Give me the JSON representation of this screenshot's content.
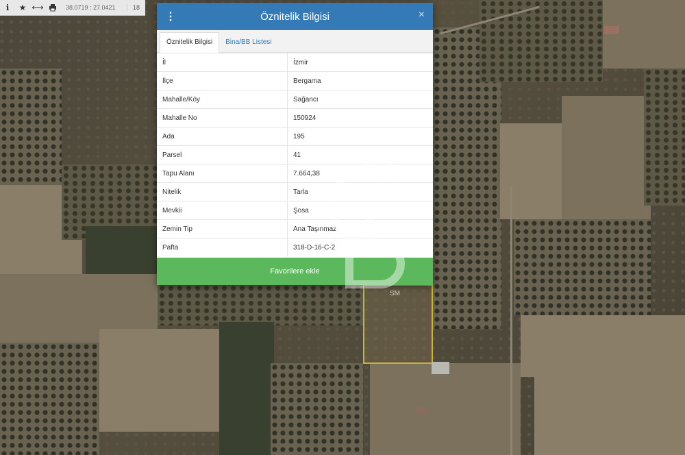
{
  "toolbar": {
    "coords": "38.0719 : 27.0421",
    "zoom": "18",
    "icons": [
      "info-icon",
      "star-icon",
      "measure-icon",
      "print-icon"
    ]
  },
  "dialog": {
    "title": "Öznitelik Bilgisi",
    "close_symbol": "×",
    "menu_symbol": "⋮",
    "tabs": [
      {
        "label": "Öznitelik Bilgisi",
        "active": true
      },
      {
        "label": "Bina/BB Listesi",
        "active": false
      }
    ],
    "rows": [
      {
        "key": "İl",
        "value": "İzmir"
      },
      {
        "key": "İlçe",
        "value": "Bergama"
      },
      {
        "key": "Mahalle/Köy",
        "value": "Sağancı"
      },
      {
        "key": "Mahalle No",
        "value": "150924"
      },
      {
        "key": "Ada",
        "value": "195"
      },
      {
        "key": "Parsel",
        "value": "41"
      },
      {
        "key": "Tapu Alanı",
        "value": "7.664,38"
      },
      {
        "key": "Nitelik",
        "value": "Tarla"
      },
      {
        "key": "Mevkii",
        "value": "Şosa"
      },
      {
        "key": "Zemin Tip",
        "value": "Ana Taşınmaz"
      },
      {
        "key": "Pafta",
        "value": "318-D-16-C-2"
      }
    ],
    "favorite_button": "Favorilere ekle"
  },
  "map": {
    "parcel_label": "SM"
  },
  "colors": {
    "header": "#337ab7",
    "favorite": "#5cb85c",
    "link": "#337ab7"
  }
}
